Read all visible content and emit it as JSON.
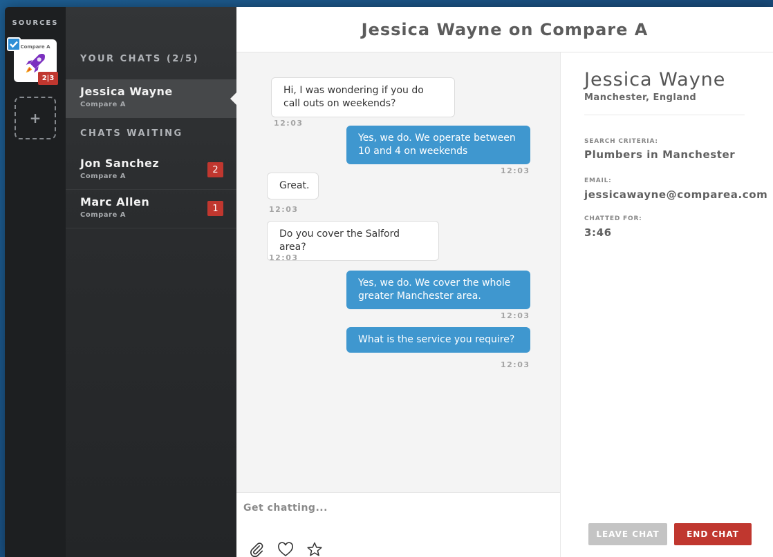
{
  "sources": {
    "label": "SOURCES",
    "items": [
      {
        "name": "Compare A",
        "badge": "2|3",
        "icon": "rocket-icon",
        "selected": true
      }
    ],
    "add_icon": "plus-icon"
  },
  "chats": {
    "your_chats_heading": "YOUR CHATS  (2/5)",
    "active": {
      "name": "Jessica Wayne",
      "source": "Compare A"
    },
    "waiting_heading": "CHATS WAITING",
    "waiting": [
      {
        "name": "Jon Sanchez",
        "source": "Compare A",
        "count": "2"
      },
      {
        "name": "Marc Allen",
        "source": "Compare A",
        "count": "1"
      }
    ]
  },
  "header": {
    "title": "Jessica Wayne on Compare A"
  },
  "messages": [
    {
      "dir": "in",
      "text": "Hi, I was wondering if you do call outs on weekends?",
      "time": "12:03"
    },
    {
      "dir": "out",
      "text": "Yes, we do. We operate between 10 and 4 on weekends",
      "time": "12:03"
    },
    {
      "dir": "in",
      "text": "Great.",
      "time": "12:03"
    },
    {
      "dir": "in",
      "text": "Do you cover the Salford area?",
      "time": "12:03"
    },
    {
      "dir": "out",
      "text": "Yes, we do. We cover the whole greater Manchester area.",
      "time": "12:03"
    },
    {
      "dir": "out",
      "text": "What is the service you require?",
      "time": "12:03"
    }
  ],
  "composer": {
    "placeholder": "Get chatting...",
    "icons": [
      "paperclip-icon",
      "heart-icon",
      "star-icon"
    ]
  },
  "details": {
    "name": "Jessica Wayne",
    "location": "Manchester, England",
    "fields": [
      {
        "label": "SEARCH CRITERIA:",
        "value": "Plumbers in Manchester"
      },
      {
        "label": "EMAIL:",
        "value": "jessicawayne@comparea.com"
      },
      {
        "label": "CHATTED FOR:",
        "value": "3:46"
      }
    ],
    "leave_label": "LEAVE CHAT",
    "end_label": "END CHAT"
  },
  "colors": {
    "accent_blue": "#3f97cf",
    "badge_red": "#c0372f",
    "sidebar_dark": "#1d1f21"
  }
}
